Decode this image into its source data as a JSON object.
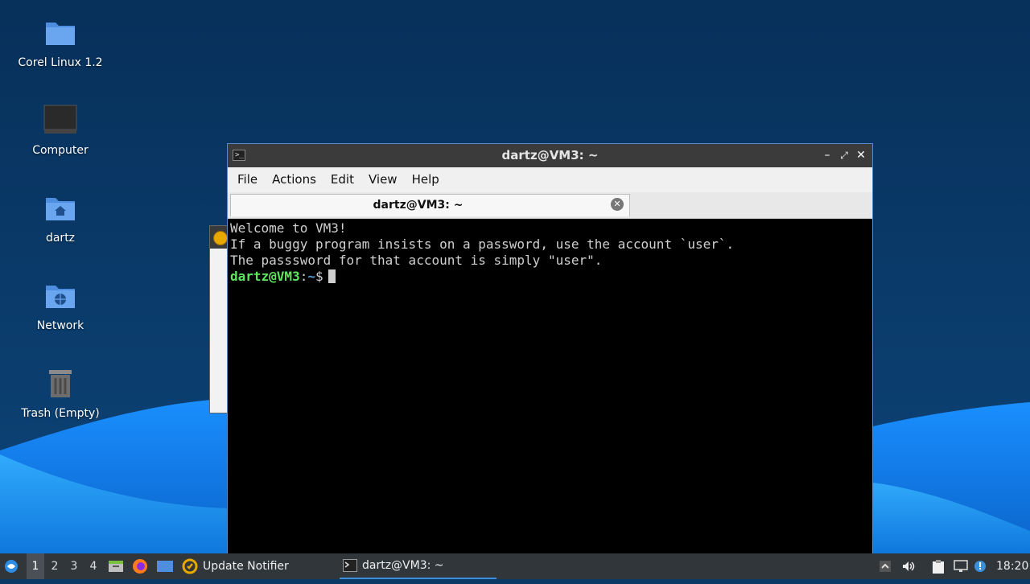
{
  "desktop": {
    "icons": [
      {
        "label": "Corel Linux 1.2",
        "icon": "folder-icon"
      },
      {
        "label": "Computer",
        "icon": "computer-icon"
      },
      {
        "label": "dartz",
        "icon": "home-folder-icon"
      },
      {
        "label": "Network",
        "icon": "network-folder-icon"
      },
      {
        "label": "Trash (Empty)",
        "icon": "trash-icon"
      }
    ]
  },
  "terminal": {
    "title": "dartz@VM3: ~",
    "menu": [
      "File",
      "Actions",
      "Edit",
      "View",
      "Help"
    ],
    "tab_label": "dartz@VM3: ~",
    "lines": [
      "Welcome to VM3!",
      "If a buggy program insists on a password, use the account `user`.",
      "The passsword for that account is simply \"user\".",
      ""
    ],
    "prompt": {
      "user_host": "dartz@VM3",
      "sep": ":",
      "path": "~",
      "symbol": "$"
    }
  },
  "taskbar": {
    "workspaces": [
      "1",
      "2",
      "3",
      "4"
    ],
    "active_workspace": "1",
    "tasks": [
      {
        "label": "Update Notifier",
        "icon": "update-notifier-icon"
      },
      {
        "label": "dartz@VM3: ~",
        "icon": "terminal-icon"
      }
    ],
    "clock": "18:20"
  },
  "colors": {
    "desktop_bg": "#0b3a66",
    "wave_light": "#1e9bff",
    "taskbar_bg": "#31363b",
    "prompt_user": "#5ee65e",
    "prompt_path": "#5b9bd5"
  }
}
